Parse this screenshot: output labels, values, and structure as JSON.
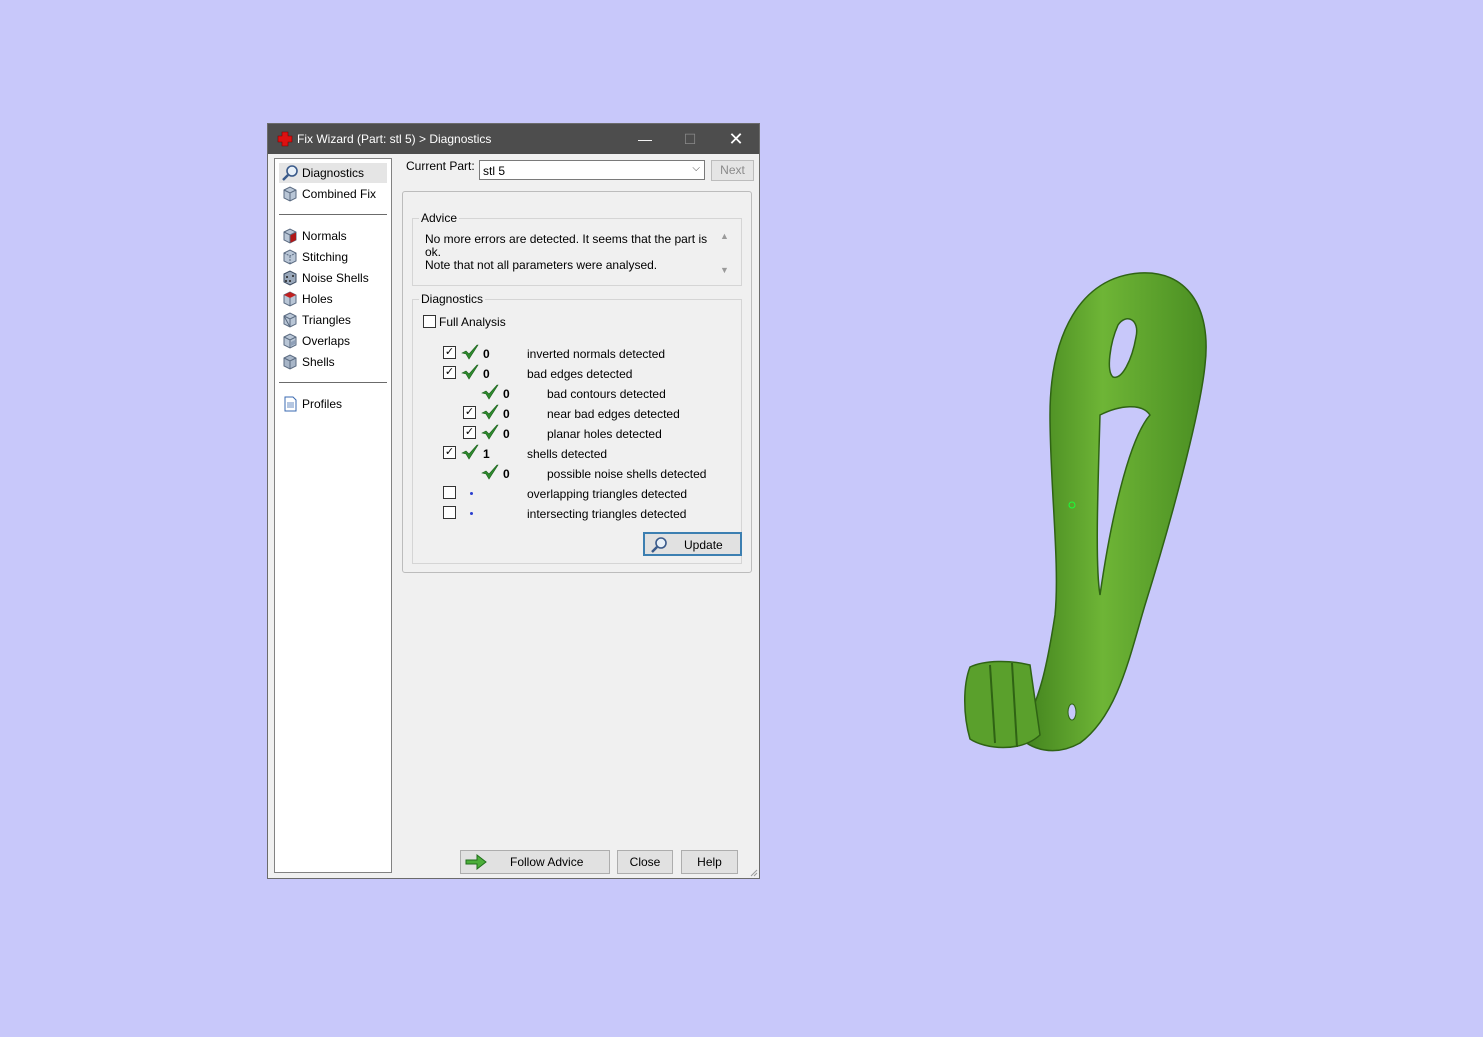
{
  "window": {
    "title": "Fix Wizard (Part: stl 5) > Diagnostics",
    "controls": {
      "minimize": "—",
      "maximize": "☐",
      "close": "✕"
    }
  },
  "sidebar": {
    "items": [
      {
        "label": "Diagnostics",
        "icon": "magnifier-icon",
        "selected": true
      },
      {
        "label": "Combined Fix",
        "icon": "cube-icon"
      },
      {
        "label": "Normals",
        "icon": "cube-red-icon"
      },
      {
        "label": "Stitching",
        "icon": "cube-stitch-icon"
      },
      {
        "label": "Noise Shells",
        "icon": "cube-noise-icon"
      },
      {
        "label": "Holes",
        "icon": "cube-hole-icon"
      },
      {
        "label": "Triangles",
        "icon": "cube-triangle-icon"
      },
      {
        "label": "Overlaps",
        "icon": "cube-overlap-icon"
      },
      {
        "label": "Shells",
        "icon": "cube-shell-icon"
      },
      {
        "label": "Profiles",
        "icon": "document-icon"
      }
    ]
  },
  "header": {
    "current_part_label": "Current Part:",
    "current_part_value": "stl 5",
    "next_label": "Next"
  },
  "advice": {
    "title": "Advice",
    "line1": "No more errors are detected. It seems that the part is ok.",
    "line2": "Note that not all parameters were analysed."
  },
  "diagnostics": {
    "title": "Diagnostics",
    "full_analysis_label": "Full Analysis",
    "full_analysis_checked": false,
    "rows": [
      {
        "checkbox": true,
        "checked": true,
        "status": "ok",
        "value": "0",
        "label": "inverted normals detected",
        "indent": 0
      },
      {
        "checkbox": true,
        "checked": true,
        "status": "ok",
        "value": "0",
        "label": "bad edges detected",
        "indent": 0
      },
      {
        "checkbox": false,
        "status": "ok",
        "value": "0",
        "label": "bad contours detected",
        "indent": 1
      },
      {
        "checkbox": true,
        "checked": true,
        "status": "ok",
        "value": "0",
        "label": "near bad edges detected",
        "indent": 1
      },
      {
        "checkbox": true,
        "checked": true,
        "status": "ok",
        "value": "0",
        "label": "planar holes detected",
        "indent": 1
      },
      {
        "checkbox": true,
        "checked": true,
        "status": "ok",
        "value": "1",
        "label": "shells detected",
        "indent": 0
      },
      {
        "checkbox": false,
        "status": "ok",
        "value": "0",
        "label": "possible noise shells detected",
        "indent": 1
      },
      {
        "checkbox": true,
        "checked": false,
        "status": "not-analysed",
        "value": "",
        "label": "overlapping triangles detected",
        "indent": 0
      },
      {
        "checkbox": true,
        "checked": false,
        "status": "not-analysed",
        "value": "",
        "label": "intersecting triangles detected",
        "indent": 0
      }
    ],
    "update_label": "Update"
  },
  "footer": {
    "follow_advice_label": "Follow Advice",
    "close_label": "Close",
    "help_label": "Help"
  },
  "colors": {
    "background": "#c8c8fa",
    "titlebar": "#4d4d4d",
    "check_green": "#2e8b2e",
    "model_green": "#5fa22e"
  }
}
